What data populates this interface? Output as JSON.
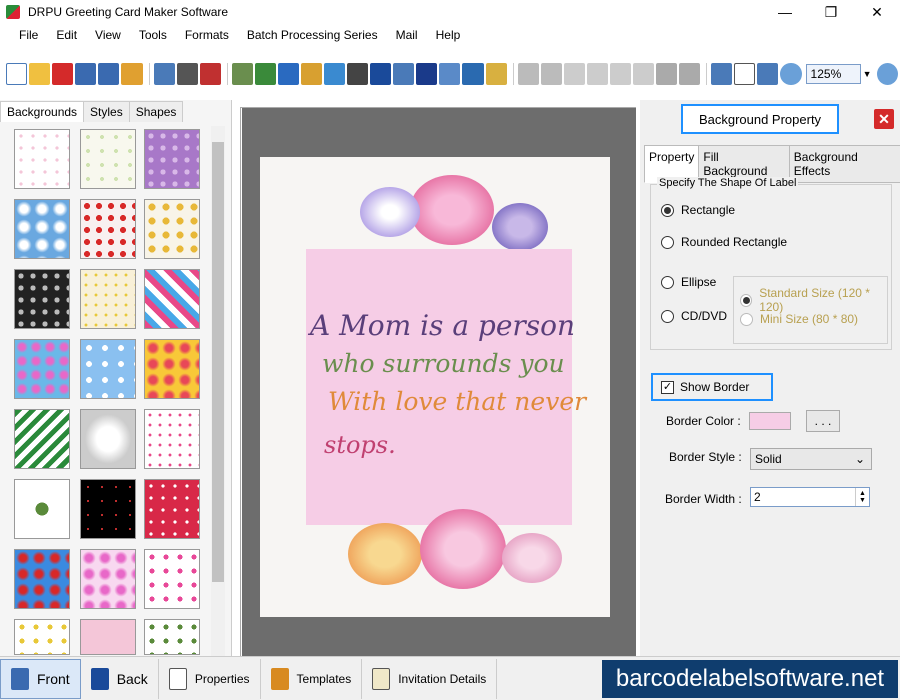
{
  "window": {
    "title": "DRPU Greeting Card Maker Software"
  },
  "menu": [
    "File",
    "Edit",
    "View",
    "Tools",
    "Formats",
    "Batch Processing Series",
    "Mail",
    "Help"
  ],
  "toolbar": {
    "zoom": "125%"
  },
  "left_panel": {
    "tabs": [
      "Backgrounds",
      "Styles",
      "Shapes"
    ],
    "active_tab": "Backgrounds"
  },
  "card": {
    "lines": [
      "A Mom is a person",
      "who surrounds you",
      "With love that never",
      "stops."
    ],
    "line_colors": [
      "#5a3f7a",
      "#6a8e4e",
      "#e08a3a",
      "#c04070"
    ]
  },
  "right_panel": {
    "title": "Background Property",
    "tabs": [
      "Property",
      "Fill Background",
      "Background Effects"
    ],
    "active_tab": "Property",
    "shape_group_label": "Specify The Shape Of Label",
    "shapes": [
      "Rectangle",
      "Rounded Rectangle",
      "Ellipse",
      "CD/DVD"
    ],
    "selected_shape": "Rectangle",
    "cd_sizes": [
      "Standard Size (120 * 120)",
      "Mini Size (80 * 80)"
    ],
    "show_border_label": "Show Border",
    "show_border_checked": true,
    "border_color_label": "Border Color :",
    "border_color": "#f6cde6",
    "dots_label": ". . .",
    "border_style_label": "Border Style :",
    "border_style_value": "Solid",
    "border_width_label": "Border Width :",
    "border_width_value": "2"
  },
  "bottom_bar": {
    "front": "Front",
    "back": "Back",
    "properties": "Properties",
    "templates": "Templates",
    "invitation": "Invitation Details"
  },
  "brand": "barcodelabelsoftware.net"
}
